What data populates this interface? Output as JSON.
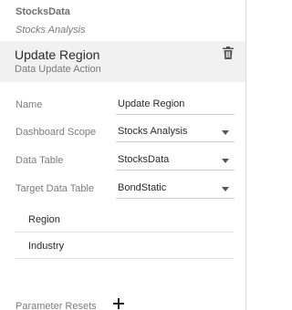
{
  "breadcrumb": {
    "data_source": "StocksData",
    "dashboard": "Stocks Analysis"
  },
  "action": {
    "title": "Update Region",
    "subtitle": "Data Update Action"
  },
  "form": {
    "name_label": "Name",
    "name_value": "Update Region",
    "scope_label": "Dashboard Scope",
    "scope_value": "Stocks Analysis",
    "table_label": "Data Table",
    "table_value": "StocksData",
    "target_label": "Target Data Table",
    "target_value": "BondStatic",
    "columns": [
      "Region",
      "Industry"
    ],
    "param_label": "Parameter Resets"
  },
  "icons": {
    "delete": "trash-icon",
    "add": "plus-icon",
    "dropdown": "chevron-down-icon"
  },
  "colors": {
    "header_band": "#f1f1f1",
    "label": "#7c7c7c",
    "text": "#2a2a2a"
  }
}
